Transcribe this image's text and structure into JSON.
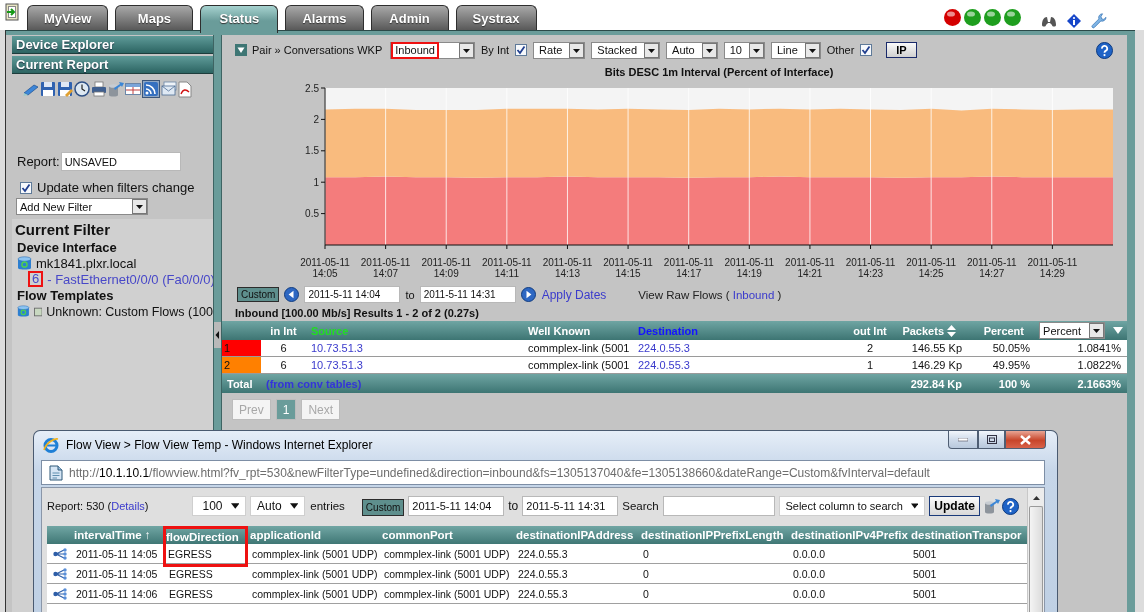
{
  "top_bar": {
    "tabs": [
      {
        "label": "MyView",
        "selected": false
      },
      {
        "label": "Maps",
        "selected": false
      },
      {
        "label": "Status",
        "selected": true
      },
      {
        "label": "Alarms",
        "selected": false
      },
      {
        "label": "Admin",
        "selected": false
      },
      {
        "label": "Systrax",
        "selected": false
      }
    ],
    "status_lights": [
      {
        "color": "#d40000"
      },
      {
        "color": "#1e9e1e"
      },
      {
        "color": "#1e9e1e"
      },
      {
        "color": "#1e9e1e"
      }
    ]
  },
  "sidebar": {
    "panels": [
      {
        "title": "Device Explorer"
      },
      {
        "title": "Current Report"
      }
    ],
    "report": {
      "label": "Report:",
      "value": "UNSAVED"
    },
    "update_option": {
      "label": "Update when filters change",
      "checked": true
    },
    "filter_select": {
      "value": "Add New Filter"
    },
    "current_filter": {
      "title": "Current Filter",
      "sections": [
        {
          "heading": "Device Interface",
          "items": [
            {
              "kind": "device",
              "label": "mk1841.plxr.local",
              "children": [
                {
                  "kind": "interface",
                  "index": "6",
                  "label": "- FastEthernet0/0/0 (Fa0/0/0)",
                  "highlighted": true
                }
              ]
            }
          ]
        },
        {
          "heading": "Flow Templates",
          "items": [
            {
              "kind": "template",
              "label": "Unknown: Custom Flows (100"
            }
          ]
        }
      ]
    }
  },
  "report": {
    "expanded": true,
    "breadcrumb": "Pair » Conversations WKP",
    "controls": [
      {
        "kind": "select",
        "value": "Inbound",
        "highlighted": true
      },
      {
        "kind": "checkbox",
        "label": "By Int",
        "checked": true
      },
      {
        "kind": "select",
        "value": "Rate",
        "highlighted": false
      },
      {
        "kind": "select",
        "value": "Stacked",
        "highlighted": false
      },
      {
        "kind": "select",
        "value": "Auto",
        "highlighted": false
      },
      {
        "kind": "select",
        "value": "10",
        "highlighted": false
      },
      {
        "kind": "select",
        "value": "Line",
        "highlighted": false
      },
      {
        "kind": "checkbox",
        "label": "Other",
        "checked": true
      },
      {
        "kind": "button",
        "label": "IP"
      }
    ],
    "chart": {
      "chart_data": {
        "type": "area",
        "stacked": true,
        "grid": true,
        "title": "Bits DESC 1m Interval (Percent of Interface)",
        "categories": [
          "2011-05-11 14:05",
          null,
          "2011-05-11 14:07",
          null,
          "2011-05-11 14:09",
          null,
          "2011-05-11 14:11",
          null,
          "2011-05-11 14:13",
          null,
          "2011-05-11 14:15",
          null,
          "2011-05-11 14:17",
          null,
          "2011-05-11 14:19",
          null,
          "2011-05-11 14:21",
          null,
          "2011-05-11 14:23",
          null,
          "2011-05-11 14:25",
          null,
          "2011-05-11 14:27",
          null,
          "2011-05-11 14:29",
          null,
          null
        ],
        "ylim": [
          0,
          2.5
        ],
        "yticks": [
          0.5,
          1,
          1.5,
          2,
          2.5
        ],
        "series": [
          {
            "color": "#f47c7c",
            "values": [
              1.08,
              1.08,
              1.09,
              1.08,
              1.08,
              1.07,
              1.08,
              1.08,
              1.09,
              1.08,
              1.08,
              1.08,
              1.07,
              1.08,
              1.08,
              1.09,
              1.08,
              1.08,
              1.08,
              1.07,
              1.08,
              1.08,
              1.09,
              1.08,
              1.08,
              1.08,
              1.08
            ]
          },
          {
            "color": "#f9bb7e",
            "values": [
              1.08,
              1.09,
              1.08,
              1.07,
              1.07,
              1.08,
              1.09,
              1.09,
              1.08,
              1.08,
              1.09,
              1.08,
              1.08,
              1.09,
              1.08,
              1.08,
              1.08,
              1.09,
              1.08,
              1.08,
              1.09,
              1.06,
              1.08,
              1.08,
              1.07,
              1.08,
              1.08
            ]
          }
        ]
      }
    },
    "date_range": {
      "preset": "Custom",
      "from": "2011-5-11 14:04",
      "separator": "to",
      "to": "2011-5-11 14:31",
      "apply": "Apply Dates",
      "raw_flows": {
        "prefix": "View Raw Flows (",
        "link": "Inbound",
        "suffix": ")"
      }
    },
    "summary": "Inbound [100.00 Mb/s] Results 1 - 2 of 2 (0.27s)",
    "table": {
      "columns": [
        {
          "label": "in Int"
        },
        {
          "label": "Source",
          "color": "#22dd22"
        },
        {
          "label": "Well Known"
        },
        {
          "label": "Destination",
          "color": "#1414ff"
        },
        {
          "label": "out Int"
        },
        {
          "label": "Packets",
          "sortable": true
        },
        {
          "label": "Percent"
        },
        {
          "kind": "select",
          "value": "Percent"
        }
      ],
      "rows": [
        {
          "rank": "1",
          "color": "#ff0000",
          "cells": [
            "6",
            "10.73.51.3",
            "commplex-link (5001",
            "224.0.55.3",
            "2",
            "146.55 Kp",
            "50.05%",
            "1.0841%"
          ]
        },
        {
          "rank": "2",
          "color": "#ff8000",
          "cells": [
            "6",
            "10.73.51.3",
            "commplex-link (5001",
            "224.0.55.3",
            "1",
            "146.29 Kp",
            "49.95%",
            "1.0822%"
          ]
        }
      ],
      "total": {
        "label": "Total",
        "note": "(from conv tables)",
        "packets": "292.84 Kp",
        "percent": "100 %",
        "value": "2.1663%"
      }
    },
    "pagination": [
      {
        "label": "Prev",
        "disabled": true,
        "selected": false
      },
      {
        "label": "1",
        "disabled": false,
        "selected": true
      },
      {
        "label": "Next",
        "disabled": true,
        "selected": false
      }
    ]
  },
  "popup": {
    "title": "Flow View > Flow View Temp - Windows Internet Explorer",
    "address": "http://**10.1.10.1**/flowview.html?fv_rpt=530&newFilterType=undefined&direction=inbound&fs=1305137040&fe=1305138660&dateRange=Custom&fvInterval=default",
    "report_info": {
      "prefix": "Report: 530 (",
      "link": "Details",
      "suffix": ")"
    },
    "entry_selects": [
      {
        "value": "100"
      },
      {
        "value": "Auto"
      }
    ],
    "entries_label": "entries",
    "preset": "Custom",
    "from": "2011-5-11 14:04",
    "separator": "to",
    "to": "2011-5-11 14:31",
    "search_label": "Search",
    "search_column": "Select column to search",
    "update": "Update",
    "table": {
      "columns": [
        {
          "label": "intervalTime ↑",
          "highlighted": false
        },
        {
          "label": "flowDirection",
          "highlighted": true
        },
        {
          "label": "applicationId",
          "highlighted": false
        },
        {
          "label": "commonPort",
          "highlighted": false
        },
        {
          "label": "destinationIPAddress",
          "highlighted": false
        },
        {
          "label": "destinationIPPrefixLength",
          "highlighted": false
        },
        {
          "label": "destinationIPv4Prefix",
          "highlighted": false
        },
        {
          "label": "destinationTranspor",
          "highlighted": false
        }
      ],
      "rows": [
        [
          "2011-05-11 14:05",
          "EGRESS",
          "commplex-link (5001 UDP)",
          "commplex-link (5001 UDP)",
          "224.0.55.3",
          "0",
          "0.0.0.0",
          "5001"
        ],
        [
          "2011-05-11 14:05",
          "EGRESS",
          "commplex-link (5001 UDP)",
          "commplex-link (5001 UDP)",
          "224.0.55.3",
          "0",
          "0.0.0.0",
          "5001"
        ],
        [
          "2011-05-11 14:06",
          "EGRESS",
          "commplex-link (5001 UDP)",
          "commplex-link (5001 UDP)",
          "224.0.55.3",
          "0",
          "0.0.0.0",
          "5001"
        ]
      ]
    }
  }
}
